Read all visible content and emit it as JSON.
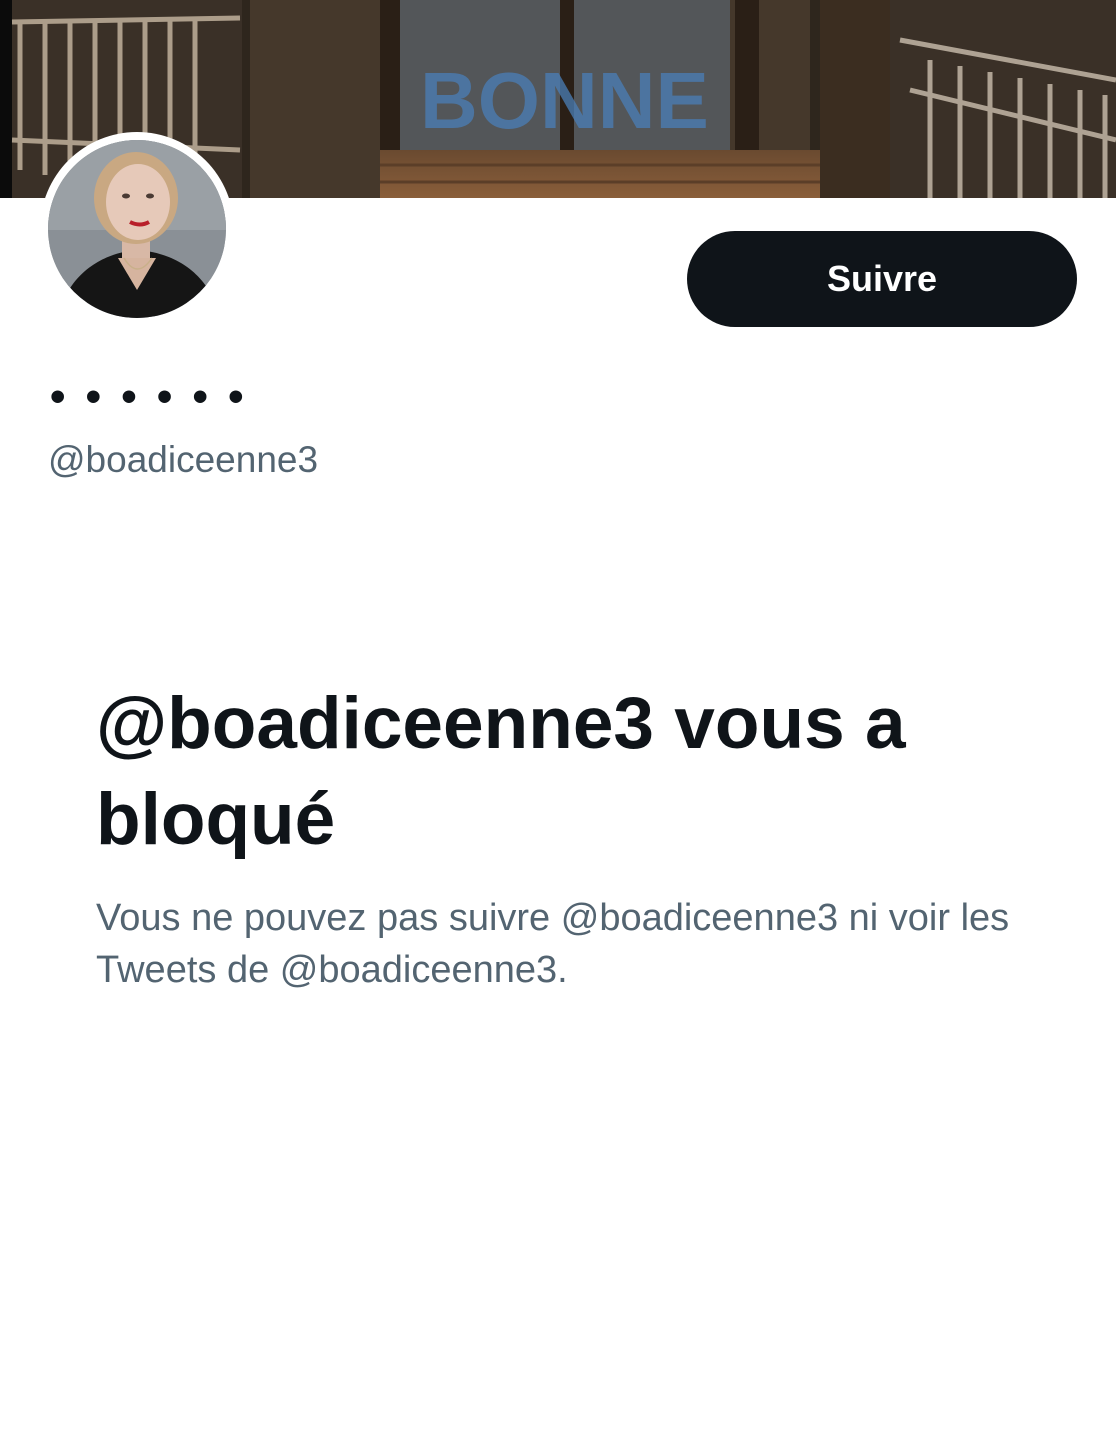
{
  "profile": {
    "display_name": "• • • • • •",
    "handle": "@boadiceenne3"
  },
  "header": {
    "banner_text": "BONNE",
    "follow_label": "Suivre"
  },
  "blocked": {
    "title": "@boadiceenne3 vous a bloqué",
    "description": "Vous ne pouvez pas suivre @boadiceenne3 ni voir les Tweets de @boadiceenne3."
  },
  "colors": {
    "primary_text": "#0f1419",
    "secondary_text": "#536471",
    "button_bg": "#0f1419",
    "button_text": "#ffffff",
    "background": "#ffffff"
  }
}
